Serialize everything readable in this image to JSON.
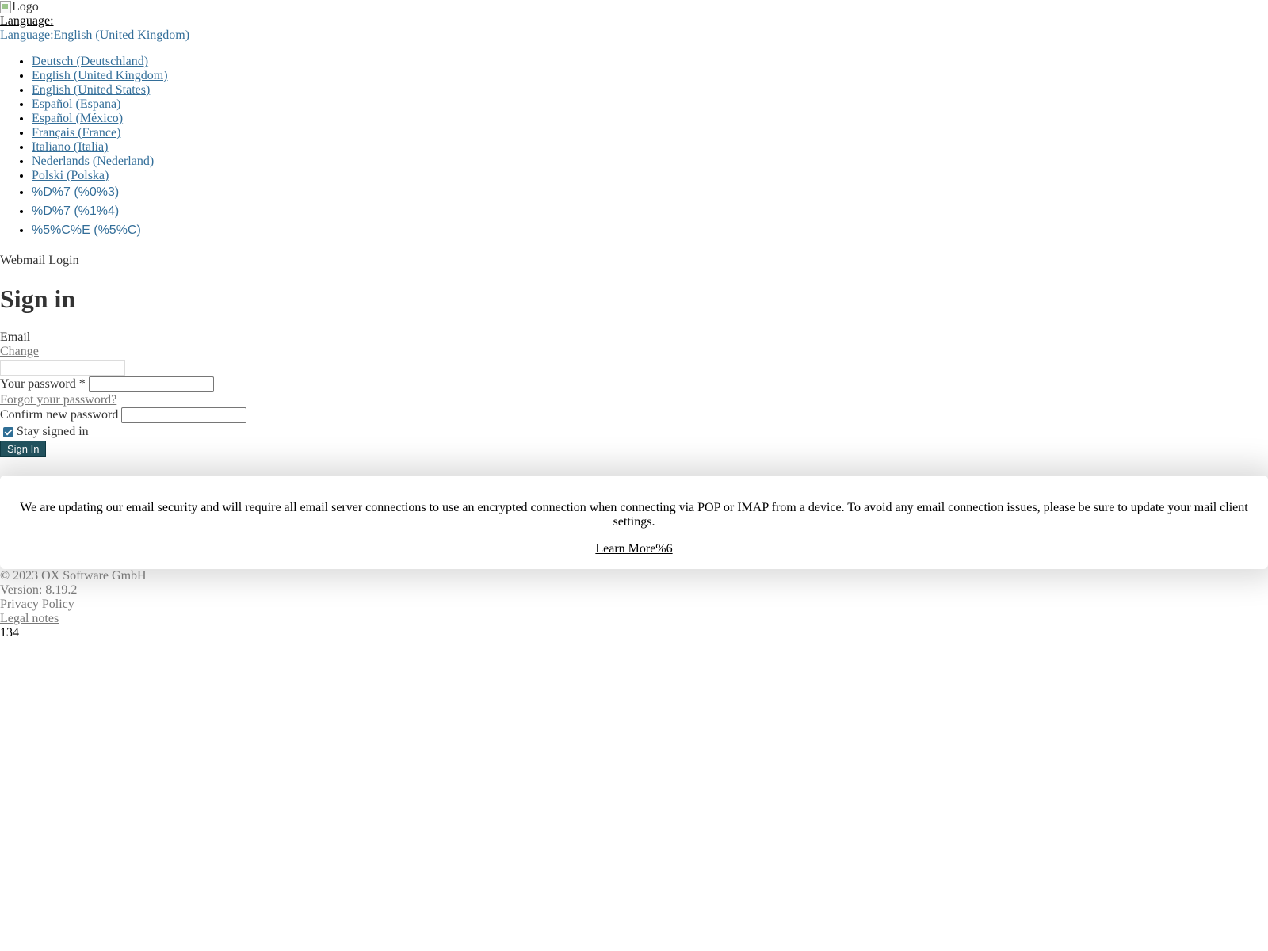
{
  "header": {
    "logo_alt": "Logo",
    "language_label": "Language:",
    "language_current_prefix": "Language:",
    "language_current_value": "English (United Kingdom)"
  },
  "languages": [
    "Deutsch (Deutschland)",
    "English (United Kingdom)",
    "English (United States)",
    "Español (Espana)",
    "Español (México)",
    "Français (France)",
    "Italiano (Italia)",
    "Nederlands (Nederland)",
    "Polski (Polska)",
    "%D%7 (%0%3)",
    "%D%7 (%1%4)",
    "%5%C%E (%5%C)"
  ],
  "login": {
    "product_title": "Webmail Login",
    "heading": "Sign in",
    "email_label": "Email",
    "change_link": "Change",
    "email_value": "",
    "password_label": "Your password *",
    "password_value": "",
    "forgot_link": "Forgot your password?",
    "confirm_label": "Confirm new password",
    "confirm_value": "",
    "stay_signed_in_label": "Stay signed in",
    "stay_signed_in_checked": true,
    "signin_button": "Sign In"
  },
  "notice": {
    "text": "We are updating our email security and will require all email server connections to use an encrypted connection when connecting via POP or IMAP from a device. To avoid any email connection issues, please be sure to update your mail client settings.",
    "link_label": "Learn More%6"
  },
  "footer": {
    "copyright": "© 2023 OX Software GmbH",
    "version": "Version: 8.19.2",
    "privacy": "Privacy Policy",
    "legal": "Legal notes",
    "count": "134"
  },
  "colors": {
    "link_blue": "#336e99",
    "button_bg": "#23535f",
    "muted_text": "#777777",
    "checkbox_accent": "#2f6e95"
  },
  "icons": {
    "logo": "broken-image-icon",
    "checkbox": "checkmark-icon"
  }
}
